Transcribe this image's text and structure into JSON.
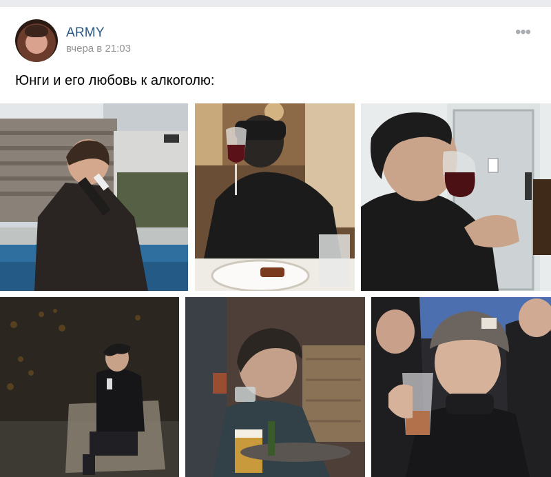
{
  "post": {
    "author": "ARMY",
    "time": "вчера в 21:03",
    "text": "Юнги и его любовь к алкоголю:",
    "more_icon": "•••"
  },
  "photos": [
    {
      "name": "photo-pool-bottle"
    },
    {
      "name": "photo-wine-glass-restaurant"
    },
    {
      "name": "photo-wine-glass-profile"
    },
    {
      "name": "photo-garden-chair"
    },
    {
      "name": "photo-drinking-shot"
    },
    {
      "name": "photo-plastic-cup-beanie"
    }
  ],
  "colors": {
    "author": "#2a5885",
    "time": "#939393",
    "more": "#a8adb3"
  }
}
